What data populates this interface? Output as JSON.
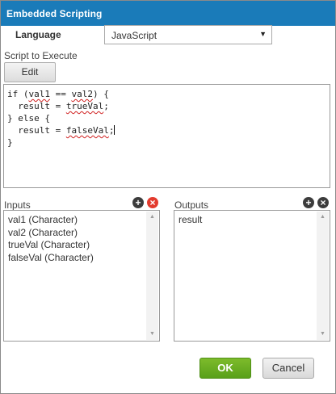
{
  "dialog": {
    "title": "Embedded Scripting"
  },
  "language": {
    "label": "Language",
    "selected": "JavaScript"
  },
  "script": {
    "label": "Script to Execute",
    "edit_button": "Edit",
    "lines": [
      "if (val1 == val2) {",
      "  result = trueVal;",
      "} else {",
      "  result = falseVal;",
      "}"
    ]
  },
  "inputs": {
    "label": "Inputs",
    "items": [
      "val1 (Character)",
      "val2 (Character)",
      "trueVal (Character)",
      "falseVal (Character)"
    ]
  },
  "outputs": {
    "label": "Outputs",
    "items": [
      "result"
    ]
  },
  "buttons": {
    "ok": "OK",
    "cancel": "Cancel"
  },
  "colors": {
    "title_bar": "#1a7bb9",
    "ok_button": "#6cae22",
    "delete_red": "#e33b2e"
  },
  "icons": {
    "add": "plus-circle-icon",
    "delete": "x-circle-icon",
    "dropdown": "caret-down-icon",
    "scroll_up": "arrow-up-icon",
    "scroll_down": "arrow-down-icon"
  }
}
